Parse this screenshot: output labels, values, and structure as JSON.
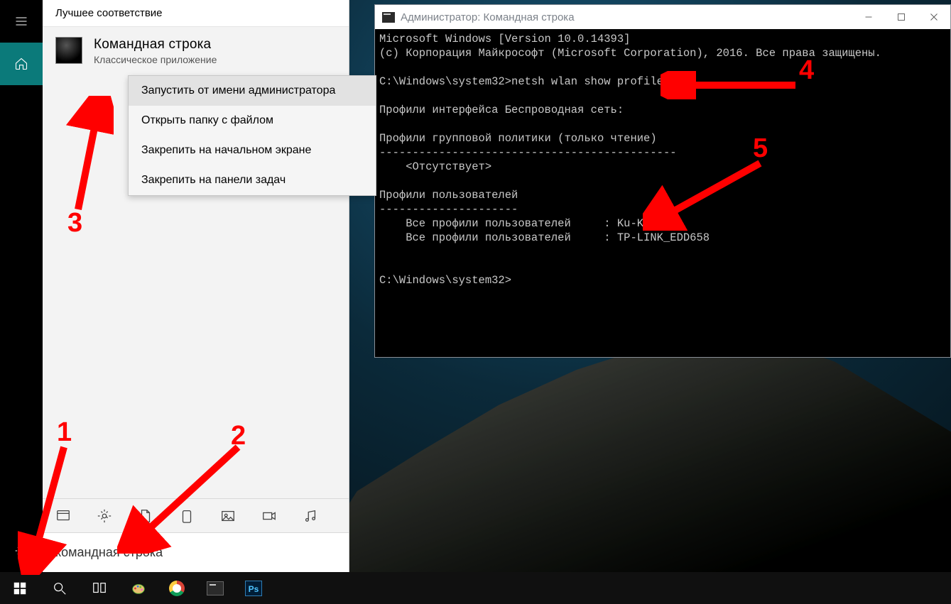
{
  "search": {
    "best_match_label": "Лучшее соответствие",
    "app_title": "Командная строка",
    "app_sub": "Классическое приложение",
    "context_items": [
      "Запустить от имени администратора",
      "Открыть папку с файлом",
      "Закрепить на начальном экране",
      "Закрепить на панели задач"
    ],
    "query": "командная строка"
  },
  "cmd": {
    "title": "Администратор: Командная строка",
    "prompt1": "C:\\Windows\\system32>",
    "command1": "netsh wlan show profiles",
    "lines": {
      "l1": "Microsoft Windows [Version 10.0.14393]",
      "l2": "(c) Корпорация Майкрософт (Microsoft Corporation), 2016. Все права защищены.",
      "blank": "",
      "iface": "Профили интерфейса Беспроводная сеть:",
      "gp_head": "Профили групповой политики (только чтение)",
      "gp_dash": "---------------------------------------------",
      "gp_none": "    <Отсутствует>",
      "up_head": "Профили пользователей",
      "up_dash": "---------------------",
      "up1": "    Все профили пользователей     : Ku-Ku",
      "up2": "    Все профили пользователей     : TP-LINK_EDD658",
      "prompt2": "C:\\Windows\\system32>"
    }
  },
  "annotations": {
    "n1": "1",
    "n2": "2",
    "n3": "3",
    "n4": "4",
    "n5": "5"
  },
  "ps_label": "Ps"
}
